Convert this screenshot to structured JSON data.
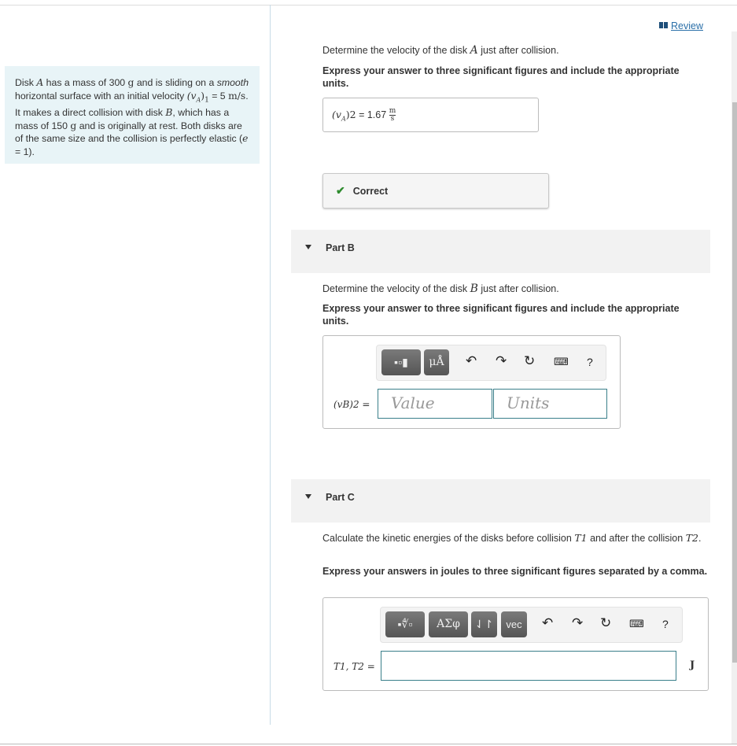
{
  "review_link": "Review",
  "problem": {
    "text": [
      "Disk ",
      "A",
      " has a mass of 300 ",
      "g",
      " and is sliding on a ",
      "smooth",
      " horizontal surface with an initial velocity ",
      "(v",
      "A",
      ")",
      "1",
      " = 5 ",
      "m/s",
      ". It makes a direct collision with disk ",
      "B",
      ", which has a mass of 150 ",
      "g",
      " and is originally at rest. Both disks are of the same size and the collision is perfectly elastic (",
      "e",
      " = 1)."
    ]
  },
  "part_a": {
    "question_pre": "Determine the velocity of the disk ",
    "question_var": "A",
    "question_post": " just after collision.",
    "instruction": "Express your answer to three significant figures and include the appropriate units.",
    "answer_label_var": "(v",
    "answer_label_sub": "A",
    "answer_label_post": ")2",
    "equals": "=",
    "answer_value": "1.67",
    "unit_num": "m",
    "unit_den": "s",
    "feedback": "Correct"
  },
  "part_b": {
    "title": "Part B",
    "question_pre": "Determine the velocity of the disk ",
    "question_var": "B",
    "question_post": " just after collision.",
    "instruction": "Express your answer to three significant figures and include the appropriate units.",
    "label": "(vB)2 =",
    "value_placeholder": "Value",
    "units_placeholder": "Units",
    "toolbar": {
      "units_btn": "μÅ",
      "help": "?"
    }
  },
  "part_c": {
    "title": "Part C",
    "question_pre": "Calculate the kinetic energies of the disks before collision ",
    "t1": "T1",
    "question_mid": " and after the collision ",
    "t2": "T2",
    "question_post": ".",
    "instruction": "Express your answers in joules to three significant figures separated by a comma.",
    "label": "T1, T2 =",
    "unit": "J",
    "toolbar": {
      "greek": "ΑΣφ",
      "sort": "⇃↾",
      "vec": "vec",
      "help": "?"
    }
  }
}
